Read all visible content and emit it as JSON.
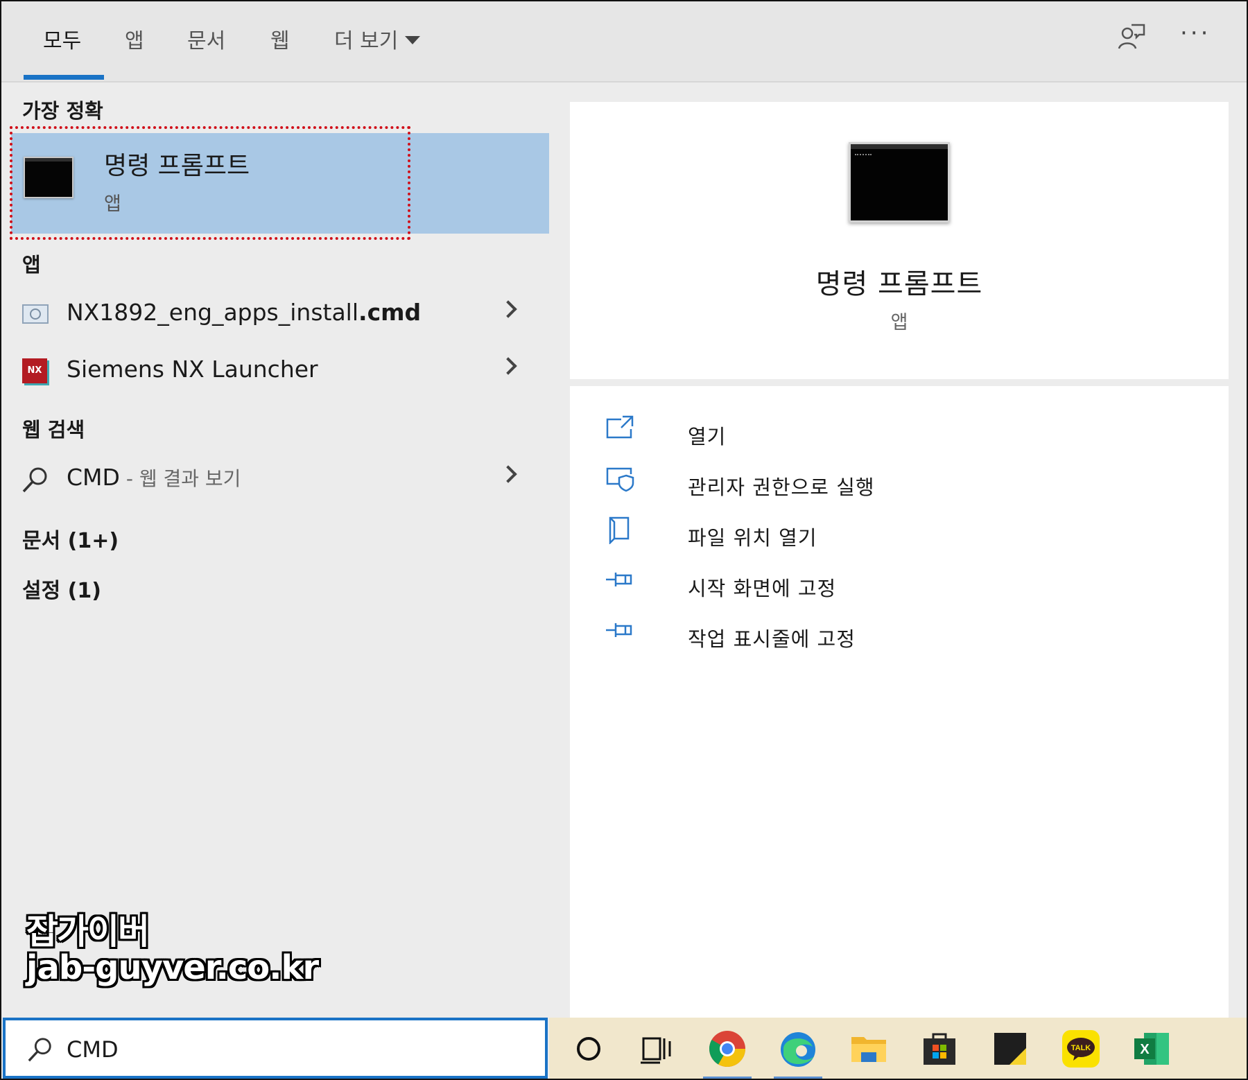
{
  "tabs": [
    {
      "label": "모두",
      "active": true
    },
    {
      "label": "앱"
    },
    {
      "label": "문서"
    },
    {
      "label": "웹"
    },
    {
      "label": "더 보기"
    }
  ],
  "sections": {
    "best_match": "가장 정확",
    "apps": "앱",
    "web_search": "웹 검색",
    "documents": "문서 (1+)",
    "settings": "설정 (1)"
  },
  "best_match": {
    "title": "명령 프롬프트",
    "subtitle": "앱",
    "icon": "command-prompt-icon"
  },
  "apps": [
    {
      "name_plain": "NX1892_eng_apps_install",
      "name_bold": ".cmd",
      "icon": "cmd-file-icon"
    },
    {
      "name_plain": "Siemens NX Launcher",
      "name_bold": "",
      "icon": "nx-launcher-icon",
      "icon_text": "NX"
    }
  ],
  "web_result": {
    "query": "CMD",
    "suffix": " - 웹 결과 보기"
  },
  "detail": {
    "title": "명령 프롬프트",
    "subtitle": "앱",
    "actions": [
      {
        "label": "열기",
        "icon": "open-icon"
      },
      {
        "label": "관리자 권한으로 실행",
        "icon": "run-as-admin-icon"
      },
      {
        "label": "파일 위치 열기",
        "icon": "file-location-icon"
      },
      {
        "label": "시작 화면에 고정",
        "icon": "pin-start-icon"
      },
      {
        "label": "작업 표시줄에 고정",
        "icon": "pin-taskbar-icon"
      }
    ]
  },
  "watermark": {
    "line1": "잡가이버",
    "line2": "jab-guyver.co.kr"
  },
  "search": {
    "value": "CMD"
  },
  "taskbar_items": [
    "cortana-icon",
    "task-view-icon",
    "chrome-icon",
    "edge-icon",
    "file-explorer-icon",
    "store-icon",
    "sticky-notes-icon",
    "kakaotalk-icon",
    "excel-icon"
  ],
  "taskbar_text": {
    "kakao": "TALK",
    "excel": "X"
  },
  "colors": {
    "accent": "#1a73c6",
    "selection": "#a9c8e5",
    "highlight_border": "#d0101a",
    "taskbar": "#f1e7cc"
  }
}
